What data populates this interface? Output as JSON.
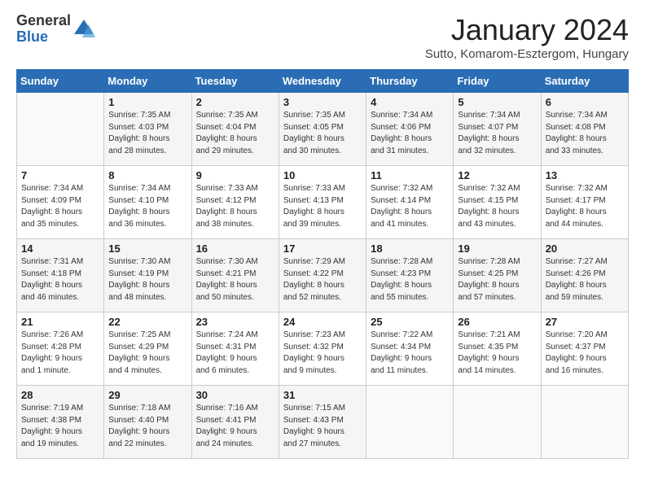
{
  "header": {
    "logo_general": "General",
    "logo_blue": "Blue",
    "month_title": "January 2024",
    "subtitle": "Sutto, Komarom-Esztergom, Hungary"
  },
  "weekdays": [
    "Sunday",
    "Monday",
    "Tuesday",
    "Wednesday",
    "Thursday",
    "Friday",
    "Saturday"
  ],
  "weeks": [
    [
      {
        "day": "",
        "info": ""
      },
      {
        "day": "1",
        "info": "Sunrise: 7:35 AM\nSunset: 4:03 PM\nDaylight: 8 hours\nand 28 minutes."
      },
      {
        "day": "2",
        "info": "Sunrise: 7:35 AM\nSunset: 4:04 PM\nDaylight: 8 hours\nand 29 minutes."
      },
      {
        "day": "3",
        "info": "Sunrise: 7:35 AM\nSunset: 4:05 PM\nDaylight: 8 hours\nand 30 minutes."
      },
      {
        "day": "4",
        "info": "Sunrise: 7:34 AM\nSunset: 4:06 PM\nDaylight: 8 hours\nand 31 minutes."
      },
      {
        "day": "5",
        "info": "Sunrise: 7:34 AM\nSunset: 4:07 PM\nDaylight: 8 hours\nand 32 minutes."
      },
      {
        "day": "6",
        "info": "Sunrise: 7:34 AM\nSunset: 4:08 PM\nDaylight: 8 hours\nand 33 minutes."
      }
    ],
    [
      {
        "day": "7",
        "info": "Sunrise: 7:34 AM\nSunset: 4:09 PM\nDaylight: 8 hours\nand 35 minutes."
      },
      {
        "day": "8",
        "info": "Sunrise: 7:34 AM\nSunset: 4:10 PM\nDaylight: 8 hours\nand 36 minutes."
      },
      {
        "day": "9",
        "info": "Sunrise: 7:33 AM\nSunset: 4:12 PM\nDaylight: 8 hours\nand 38 minutes."
      },
      {
        "day": "10",
        "info": "Sunrise: 7:33 AM\nSunset: 4:13 PM\nDaylight: 8 hours\nand 39 minutes."
      },
      {
        "day": "11",
        "info": "Sunrise: 7:32 AM\nSunset: 4:14 PM\nDaylight: 8 hours\nand 41 minutes."
      },
      {
        "day": "12",
        "info": "Sunrise: 7:32 AM\nSunset: 4:15 PM\nDaylight: 8 hours\nand 43 minutes."
      },
      {
        "day": "13",
        "info": "Sunrise: 7:32 AM\nSunset: 4:17 PM\nDaylight: 8 hours\nand 44 minutes."
      }
    ],
    [
      {
        "day": "14",
        "info": "Sunrise: 7:31 AM\nSunset: 4:18 PM\nDaylight: 8 hours\nand 46 minutes."
      },
      {
        "day": "15",
        "info": "Sunrise: 7:30 AM\nSunset: 4:19 PM\nDaylight: 8 hours\nand 48 minutes."
      },
      {
        "day": "16",
        "info": "Sunrise: 7:30 AM\nSunset: 4:21 PM\nDaylight: 8 hours\nand 50 minutes."
      },
      {
        "day": "17",
        "info": "Sunrise: 7:29 AM\nSunset: 4:22 PM\nDaylight: 8 hours\nand 52 minutes."
      },
      {
        "day": "18",
        "info": "Sunrise: 7:28 AM\nSunset: 4:23 PM\nDaylight: 8 hours\nand 55 minutes."
      },
      {
        "day": "19",
        "info": "Sunrise: 7:28 AM\nSunset: 4:25 PM\nDaylight: 8 hours\nand 57 minutes."
      },
      {
        "day": "20",
        "info": "Sunrise: 7:27 AM\nSunset: 4:26 PM\nDaylight: 8 hours\nand 59 minutes."
      }
    ],
    [
      {
        "day": "21",
        "info": "Sunrise: 7:26 AM\nSunset: 4:28 PM\nDaylight: 9 hours\nand 1 minute."
      },
      {
        "day": "22",
        "info": "Sunrise: 7:25 AM\nSunset: 4:29 PM\nDaylight: 9 hours\nand 4 minutes."
      },
      {
        "day": "23",
        "info": "Sunrise: 7:24 AM\nSunset: 4:31 PM\nDaylight: 9 hours\nand 6 minutes."
      },
      {
        "day": "24",
        "info": "Sunrise: 7:23 AM\nSunset: 4:32 PM\nDaylight: 9 hours\nand 9 minutes."
      },
      {
        "day": "25",
        "info": "Sunrise: 7:22 AM\nSunset: 4:34 PM\nDaylight: 9 hours\nand 11 minutes."
      },
      {
        "day": "26",
        "info": "Sunrise: 7:21 AM\nSunset: 4:35 PM\nDaylight: 9 hours\nand 14 minutes."
      },
      {
        "day": "27",
        "info": "Sunrise: 7:20 AM\nSunset: 4:37 PM\nDaylight: 9 hours\nand 16 minutes."
      }
    ],
    [
      {
        "day": "28",
        "info": "Sunrise: 7:19 AM\nSunset: 4:38 PM\nDaylight: 9 hours\nand 19 minutes."
      },
      {
        "day": "29",
        "info": "Sunrise: 7:18 AM\nSunset: 4:40 PM\nDaylight: 9 hours\nand 22 minutes."
      },
      {
        "day": "30",
        "info": "Sunrise: 7:16 AM\nSunset: 4:41 PM\nDaylight: 9 hours\nand 24 minutes."
      },
      {
        "day": "31",
        "info": "Sunrise: 7:15 AM\nSunset: 4:43 PM\nDaylight: 9 hours\nand 27 minutes."
      },
      {
        "day": "",
        "info": ""
      },
      {
        "day": "",
        "info": ""
      },
      {
        "day": "",
        "info": ""
      }
    ]
  ]
}
